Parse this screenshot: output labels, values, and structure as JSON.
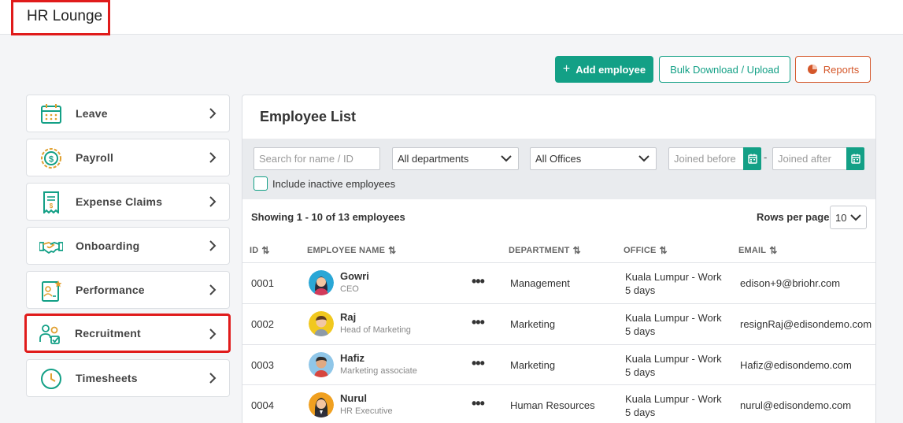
{
  "app": {
    "title": "HR Lounge"
  },
  "actions": {
    "add_label": "Add employee",
    "bulk_label": "Bulk Download / Upload",
    "reports_label": "Reports"
  },
  "sidebar": {
    "items": [
      {
        "label": "Leave",
        "icon": "calendar-icon"
      },
      {
        "label": "Payroll",
        "icon": "dollar-coin-icon"
      },
      {
        "label": "Expense Claims",
        "icon": "receipt-icon"
      },
      {
        "label": "Onboarding",
        "icon": "handshake-icon"
      },
      {
        "label": "Performance",
        "icon": "star-certificate-icon"
      },
      {
        "label": "Recruitment",
        "icon": "people-check-icon"
      },
      {
        "label": "Timesheets",
        "icon": "clock-icon"
      }
    ]
  },
  "employee_list": {
    "title": "Employee List",
    "filters": {
      "search_placeholder": "Search for name / ID",
      "department": "All departments",
      "office": "All Offices",
      "joined_before_placeholder": "Joined before",
      "joined_after_placeholder": "Joined after",
      "range_separator": "-",
      "include_inactive_label": "Include inactive employees"
    },
    "showing": "Showing 1 - 10 of 13 employees",
    "rows_per_page_label": "Rows per page",
    "rows_per_page": "10",
    "columns": [
      "ID",
      "EMPLOYEE NAME",
      "DEPARTMENT",
      "OFFICE",
      "EMAIL"
    ],
    "rows": [
      {
        "id": "0001",
        "name": "Gowri",
        "role": "CEO",
        "department": "Management",
        "office_line1": "Kuala Lumpur - Work",
        "office_line2": "5 days",
        "email": "edison+9@briohr.com"
      },
      {
        "id": "0002",
        "name": "Raj",
        "role": "Head of Marketing",
        "department": "Marketing",
        "office_line1": "Kuala Lumpur - Work",
        "office_line2": "5 days",
        "email": "resignRaj@edisondemo.com"
      },
      {
        "id": "0003",
        "name": "Hafiz",
        "role": "Marketing associate",
        "department": "Marketing",
        "office_line1": "Kuala Lumpur - Work",
        "office_line2": "5 days",
        "email": "Hafiz@edisondemo.com"
      },
      {
        "id": "0004",
        "name": "Nurul",
        "role": "HR Executive",
        "department": "Human Resources",
        "office_line1": "Kuala Lumpur - Work",
        "office_line2": "5 days",
        "email": "nurul@edisondemo.com"
      }
    ],
    "row_menu_glyph": "•••"
  },
  "colors": {
    "accent": "#13a086",
    "reports": "#d4572a",
    "highlight": "#e01b1b"
  }
}
